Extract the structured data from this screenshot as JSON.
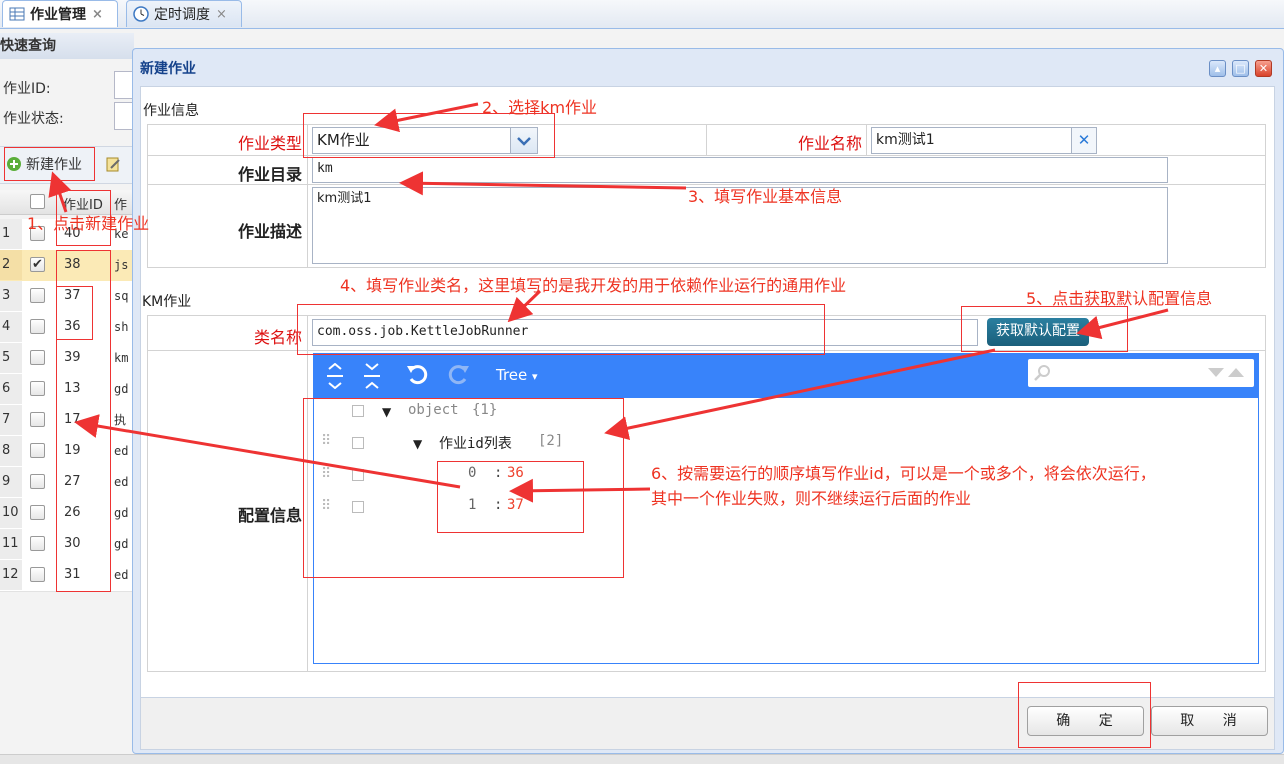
{
  "tabs": [
    {
      "label": "作业管理",
      "close": "×",
      "icon": "grid-icon"
    },
    {
      "label": "定时调度",
      "close": "×",
      "icon": "clock-icon"
    }
  ],
  "left": {
    "quick_search": "快速查询",
    "job_id_label": "作业ID:",
    "job_status_label": "作业状态:",
    "new_job_button": "新建作业",
    "col_id": "作业ID",
    "col_name": "作",
    "rows": [
      {
        "n": "1",
        "id": "40",
        "name": "ke",
        "checked": false
      },
      {
        "n": "2",
        "id": "38",
        "name": "js",
        "checked": true
      },
      {
        "n": "3",
        "id": "37",
        "name": "sq",
        "checked": false
      },
      {
        "n": "4",
        "id": "36",
        "name": "sh",
        "checked": false
      },
      {
        "n": "5",
        "id": "39",
        "name": "km",
        "checked": false
      },
      {
        "n": "6",
        "id": "13",
        "name": "gd",
        "checked": false
      },
      {
        "n": "7",
        "id": "17",
        "name": "执",
        "checked": false
      },
      {
        "n": "8",
        "id": "19",
        "name": "ed",
        "checked": false
      },
      {
        "n": "9",
        "id": "27",
        "name": "ed",
        "checked": false
      },
      {
        "n": "10",
        "id": "26",
        "name": "gd",
        "checked": false
      },
      {
        "n": "11",
        "id": "30",
        "name": "gd",
        "checked": false
      },
      {
        "n": "12",
        "id": "31",
        "name": "ed",
        "checked": false
      }
    ]
  },
  "dialog": {
    "title": "新建作业",
    "section_job_info": "作业信息",
    "job_type_label": "作业类型",
    "job_type_value": "KM作业",
    "job_name_label": "作业名称",
    "job_name_value": "km测试1",
    "job_dir_label": "作业目录",
    "job_dir_value": "km",
    "job_desc_label": "作业描述",
    "job_desc_value": "km测试1",
    "section_km": "KM作业",
    "class_name_label": "类名称",
    "class_name_value": "com.oss.job.KettleJobRunner",
    "get_default_button": "获取默认配置",
    "config_label": "配置信息",
    "editor": {
      "mode_label": "Tree",
      "mode_caret": "▾",
      "root_key": "object",
      "root_count": "{1}",
      "list_key": "作业id列表",
      "list_count": "[2]",
      "items": [
        {
          "index": "0",
          "value": "36"
        },
        {
          "index": "1",
          "value": "37"
        }
      ]
    },
    "ok_button": "确 定",
    "cancel_button": "取 消"
  },
  "annotations": {
    "a1": "1、点击新建作业",
    "a2": "2、选择km作业",
    "a3": "3、填写作业基本信息",
    "a4": "4、填写作业类名，这里填写的是我开发的用于依赖作业运行的通用作业",
    "a5": "5、点击获取默认配置信息",
    "a6_line1": "6、按需要运行的顺序填写作业id，可以是一个或多个，将会依次运行，",
    "a6_line2": "其中一个作业失败，则不继续运行后面的作业"
  },
  "colors": {
    "accent": "#3883fa",
    "annotation": "#e33333",
    "button": "#1b5f7b"
  }
}
